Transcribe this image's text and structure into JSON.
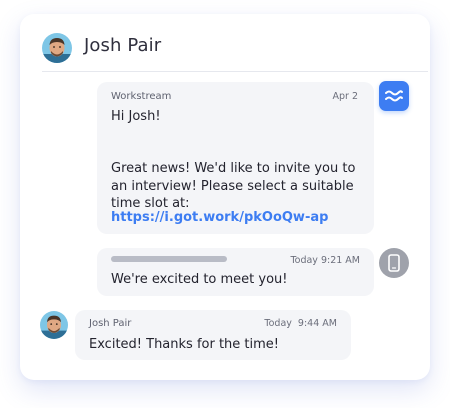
{
  "header": {
    "name": "Josh Pair",
    "avatar_icon": "person-avatar-icon"
  },
  "messages": [
    {
      "sender": "Workstream",
      "time": "Apr 2",
      "text_lines": [
        "Hi Josh!",
        "Great news! We'd like to invite you to an interview! Please select a suitable time slot at:"
      ],
      "link": "https://i.got.work/pkOoQw-ap",
      "avatar_icon": "workstream-logo-icon"
    },
    {
      "sender_hidden": true,
      "time": "Today 9:21 AM",
      "text": "We're excited to meet you!",
      "avatar_icon": "phone-icon"
    },
    {
      "sender": "Josh Pair",
      "time": "Today  9:44 AM",
      "text": "Excited! Thanks for the time!",
      "avatar_icon": "person-avatar-icon"
    }
  ],
  "colors": {
    "accent": "#3d7df2",
    "bubble": "#f4f5f8",
    "text": "#23232e",
    "muted": "#6b6e7b",
    "phone_avatar": "#9fa2ab"
  }
}
